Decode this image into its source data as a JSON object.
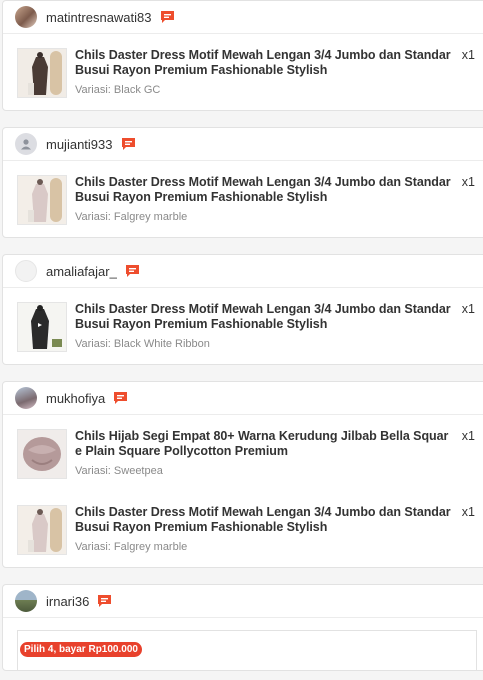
{
  "orders": [
    {
      "username": "matintresnawati83",
      "avatar": "photo",
      "items": [
        {
          "title": "Chils Daster Dress Motif Mewah Lengan 3/4 Jumbo dan Standar Busui Rayon Premium Fashionable Stylish",
          "variant": "Variasi: Black GC",
          "qty": "x1",
          "thumb": "dress-dark"
        }
      ]
    },
    {
      "username": "mujianti933",
      "avatar": "default",
      "items": [
        {
          "title": "Chils Daster Dress Motif Mewah Lengan 3/4 Jumbo dan Standar Busui Rayon Premium Fashionable Stylish",
          "variant": "Variasi: Falgrey marble",
          "qty": "x1",
          "thumb": "dress-light"
        }
      ]
    },
    {
      "username": "amaliafajar_",
      "avatar": "blank",
      "items": [
        {
          "title": "Chils Daster Dress Motif Mewah Lengan 3/4 Jumbo dan Standar Busui Rayon Premium Fashionable Stylish",
          "variant": "Variasi: Black White Ribbon",
          "qty": "x1",
          "thumb": "dress-bw"
        }
      ]
    },
    {
      "username": "mukhofiya",
      "avatar": "photo2",
      "items": [
        {
          "title": "Chils Hijab Segi Empat 80+ Warna Kerudung Jilbab Bella Square Plain Square Pollycotton Premium",
          "variant": "Variasi: Sweetpea",
          "qty": "x1",
          "thumb": "hijab"
        },
        {
          "title": "Chils Daster Dress Motif Mewah Lengan 3/4 Jumbo dan Standar Busui Rayon Premium Fashionable Stylish",
          "variant": "Variasi: Falgrey marble",
          "qty": "x1",
          "thumb": "dress-light"
        }
      ]
    },
    {
      "username": "irnari36",
      "avatar": "photo3",
      "promo": "Pilih 4, bayar Rp100.000",
      "items": []
    }
  ],
  "colors": {
    "chat": "#ee4d2d",
    "promo": "#e8412c"
  }
}
